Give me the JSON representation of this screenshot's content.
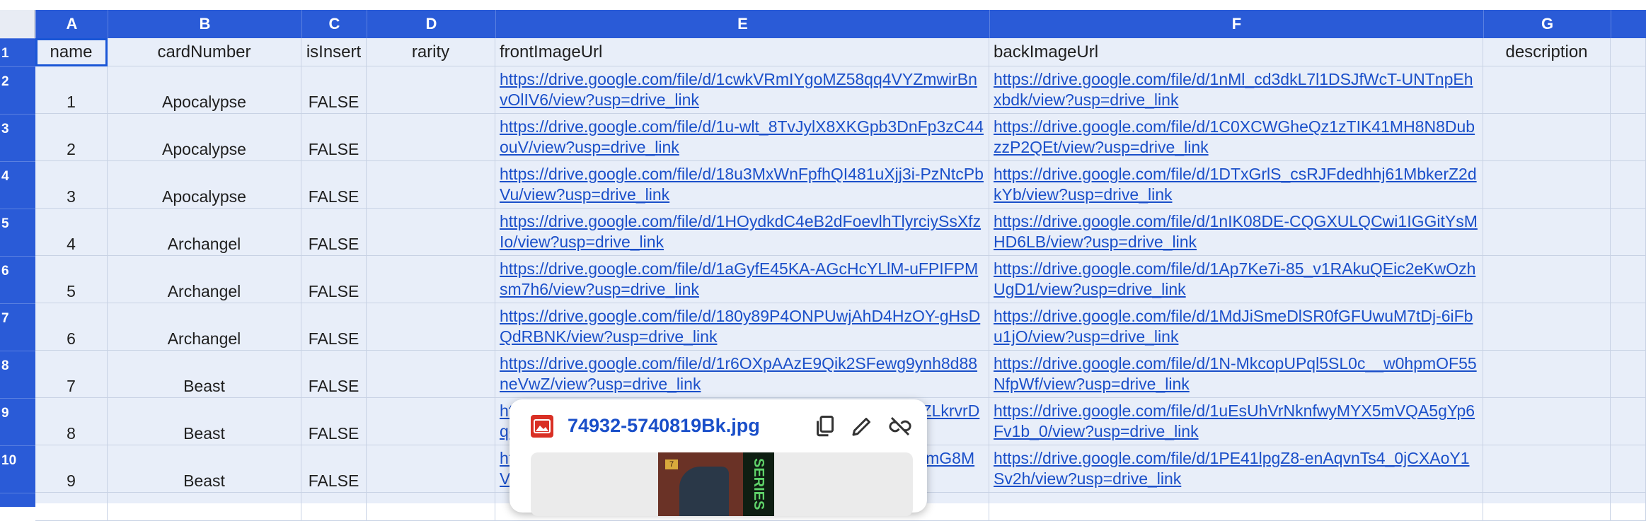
{
  "column_headers": [
    "A",
    "B",
    "C",
    "D",
    "E",
    "F",
    "G"
  ],
  "row_headers": [
    "1",
    "2",
    "3",
    "4",
    "5",
    "6",
    "7",
    "8",
    "9",
    "10"
  ],
  "header_row": {
    "name": "name",
    "cardNumber": "cardNumber",
    "isInsert": "isInsert",
    "rarity": "rarity",
    "frontImageUrl": "frontImageUrl",
    "backImageUrl": "backImageUrl",
    "description": "description"
  },
  "rows": [
    {
      "name": "1",
      "cardNumber": "Apocalypse",
      "isInsert": "FALSE",
      "rarity": "",
      "front_url": "https://drive.google.com/file/d/1cwkVRmIYgoMZ58qq4VYZmwirBnvOlIV6/view?usp=drive_link",
      "back_url": "https://drive.google.com/file/d/1nMl_cd3dkL7l1DSJfWcT-UNTnpEhxbdk/view?usp=drive_link",
      "description": ""
    },
    {
      "name": "2",
      "cardNumber": "Apocalypse",
      "isInsert": "FALSE",
      "rarity": "",
      "front_url": "https://drive.google.com/file/d/1u-wlt_8TvJylX8XKGpb3DnFp3zC44ouV/view?usp=drive_link",
      "back_url": "https://drive.google.com/file/d/1C0XCWGheQz1zTIK41MH8N8DubzzP2QEt/view?usp=drive_link",
      "description": ""
    },
    {
      "name": "3",
      "cardNumber": "Apocalypse",
      "isInsert": "FALSE",
      "rarity": "",
      "front_url": "https://drive.google.com/file/d/18u3MxWnFpfhQI481uXjj3i-PzNtcPbVu/view?usp=drive_link",
      "back_url": "https://drive.google.com/file/d/1DTxGrlS_csRJFdedhhj61MbkerZ2dkYb/view?usp=drive_link",
      "description": ""
    },
    {
      "name": "4",
      "cardNumber": "Archangel",
      "isInsert": "FALSE",
      "rarity": "",
      "front_url": "https://drive.google.com/file/d/1HOydkdC4eB2dFoevlhTlyrciySsXfzIo/view?usp=drive_link",
      "back_url": "https://drive.google.com/file/d/1nIK08DE-CQGXULQCwi1IGGitYsMHD6LB/view?usp=drive_link",
      "description": ""
    },
    {
      "name": "5",
      "cardNumber": "Archangel",
      "isInsert": "FALSE",
      "rarity": "",
      "front_url": "https://drive.google.com/file/d/1aGyfE45KA-AGcHcYLlM-uFPIFPMsm7h6/view?usp=drive_link",
      "back_url": "https://drive.google.com/file/d/1Ap7Ke7i-85_v1RAkuQEic2eKwOzhUgD1/view?usp=drive_link",
      "description": ""
    },
    {
      "name": "6",
      "cardNumber": "Archangel",
      "isInsert": "FALSE",
      "rarity": "",
      "front_url": "https://drive.google.com/file/d/180y89P4ONPUwjAhD4HzOY-gHsDQdRBNK/view?usp=drive_link",
      "back_url": "https://drive.google.com/file/d/1MdJiSmeDlSR0fGFUwuM7tDj-6iFbu1jO/view?usp=drive_link",
      "description": ""
    },
    {
      "name": "7",
      "cardNumber": "Beast",
      "isInsert": "FALSE",
      "rarity": "",
      "front_url": "https://drive.google.com/file/d/1r6OXpAAzE9Qik2SFewg9ynh8d88neVwZ/view?usp=drive_link",
      "back_url": "https://drive.google.com/file/d/1N-MkcopUPql5SL0c__w0hpmOF55NfpWf/view?usp=drive_link",
      "description": ""
    },
    {
      "name": "8",
      "cardNumber": "Beast",
      "isInsert": "FALSE",
      "rarity": "",
      "front_url": "https://drive.google.com/file/d/1kWrVGNz1lvSb0Mj4pHsP3ZLkrvrDqcBZ3kWyBdCE7/view?usp=drive_link",
      "back_url": "https://drive.google.com/file/d/1uEsUhVrNknfwyMYX5mVQA5gYp6Fv1b_0/view?usp=drive_link",
      "description": ""
    },
    {
      "name": "9",
      "cardNumber": "Beast",
      "isInsert": "FALSE",
      "rarity": "",
      "front_url": "https://drive.google.com/file/d/1xQ2bDtJwE7pNcHqYtA4uRmG8MVk7kUxTQ9pZvLwHr/view?usp=drive_link",
      "back_url": "https://drive.google.com/file/d/1PE41lpgZ8-enAqvnTs4_0jCXAoY1Sv2h/view?usp=drive_link",
      "description": ""
    }
  ],
  "popup": {
    "file_name": "74932-5740819Bk.jpg",
    "preview_card_number": "7",
    "preview_side_text": "SERIES",
    "icons": [
      "image-file-icon",
      "copy-icon",
      "edit-icon",
      "unlink-icon"
    ]
  },
  "colors": {
    "header_blue": "#2a5bd7",
    "cell_background": "#e8eef9",
    "link": "#1a4fc9",
    "selection": "#1a56d6"
  }
}
